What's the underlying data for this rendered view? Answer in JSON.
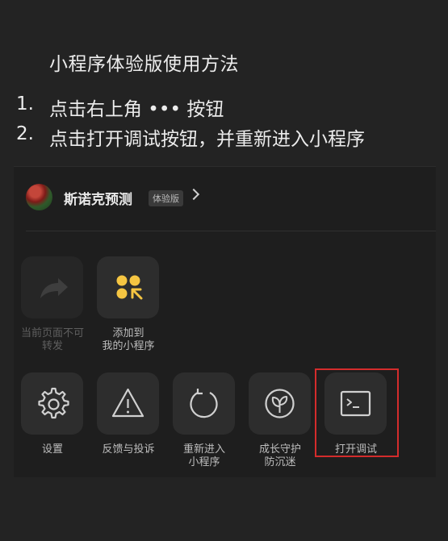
{
  "heading": "小程序体验版使用方法",
  "steps": [
    {
      "num": "1.",
      "text": "点击右上角 ••• 按钮"
    },
    {
      "num": "2.",
      "text": "点击打开调试按钮，并重新进入小程序"
    }
  ],
  "panel": {
    "app_name": "斯诺克预测",
    "badge": "体验版",
    "row1": [
      {
        "line1": "当前页面不可",
        "line2": "转发",
        "icon": "share-icon",
        "enabled": false
      },
      {
        "line1": "添加到",
        "line2": "我的小程序",
        "icon": "add-to-my-miniprogram-icon",
        "enabled": true
      }
    ],
    "row2": [
      {
        "line1": "设置",
        "line2": "",
        "icon": "gear-icon"
      },
      {
        "line1": "反馈与投诉",
        "line2": "",
        "icon": "warning-icon"
      },
      {
        "line1": "重新进入",
        "line2": "小程序",
        "icon": "reload-icon"
      },
      {
        "line1": "成长守护",
        "line2": "防沉迷",
        "icon": "sprout-icon"
      },
      {
        "line1": "打开调试",
        "line2": "",
        "icon": "terminal-icon"
      }
    ]
  },
  "colors": {
    "accent_yellow": "#f5c542",
    "highlight_red": "#d42c2c"
  }
}
